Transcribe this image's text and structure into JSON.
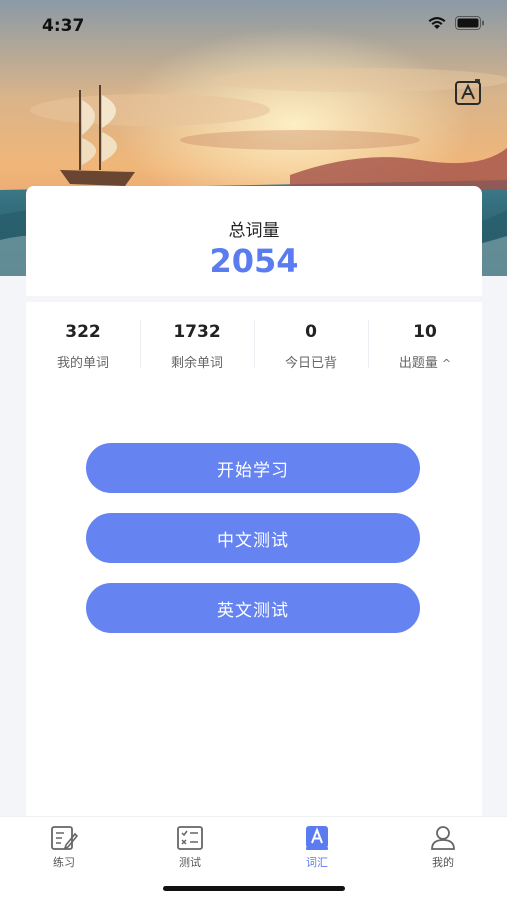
{
  "status": {
    "time": "4:37"
  },
  "summary": {
    "label": "总词量",
    "value": "2054"
  },
  "stats": [
    {
      "value": "322",
      "label": "我的单词"
    },
    {
      "value": "1732",
      "label": "剩余单词"
    },
    {
      "value": "0",
      "label": "今日已背"
    },
    {
      "value": "10",
      "label": "出题量"
    }
  ],
  "buttons": {
    "start": "开始学习",
    "cn_test": "中文测试",
    "en_test": "英文测试"
  },
  "tabs": [
    {
      "label": "练习",
      "icon": "practice-icon"
    },
    {
      "label": "测试",
      "icon": "test-icon"
    },
    {
      "label": "词汇",
      "icon": "vocabulary-icon",
      "active": true
    },
    {
      "label": "我的",
      "icon": "profile-icon"
    }
  ],
  "colors": {
    "accent": "#5b7cf0",
    "button": "#6683f2"
  }
}
